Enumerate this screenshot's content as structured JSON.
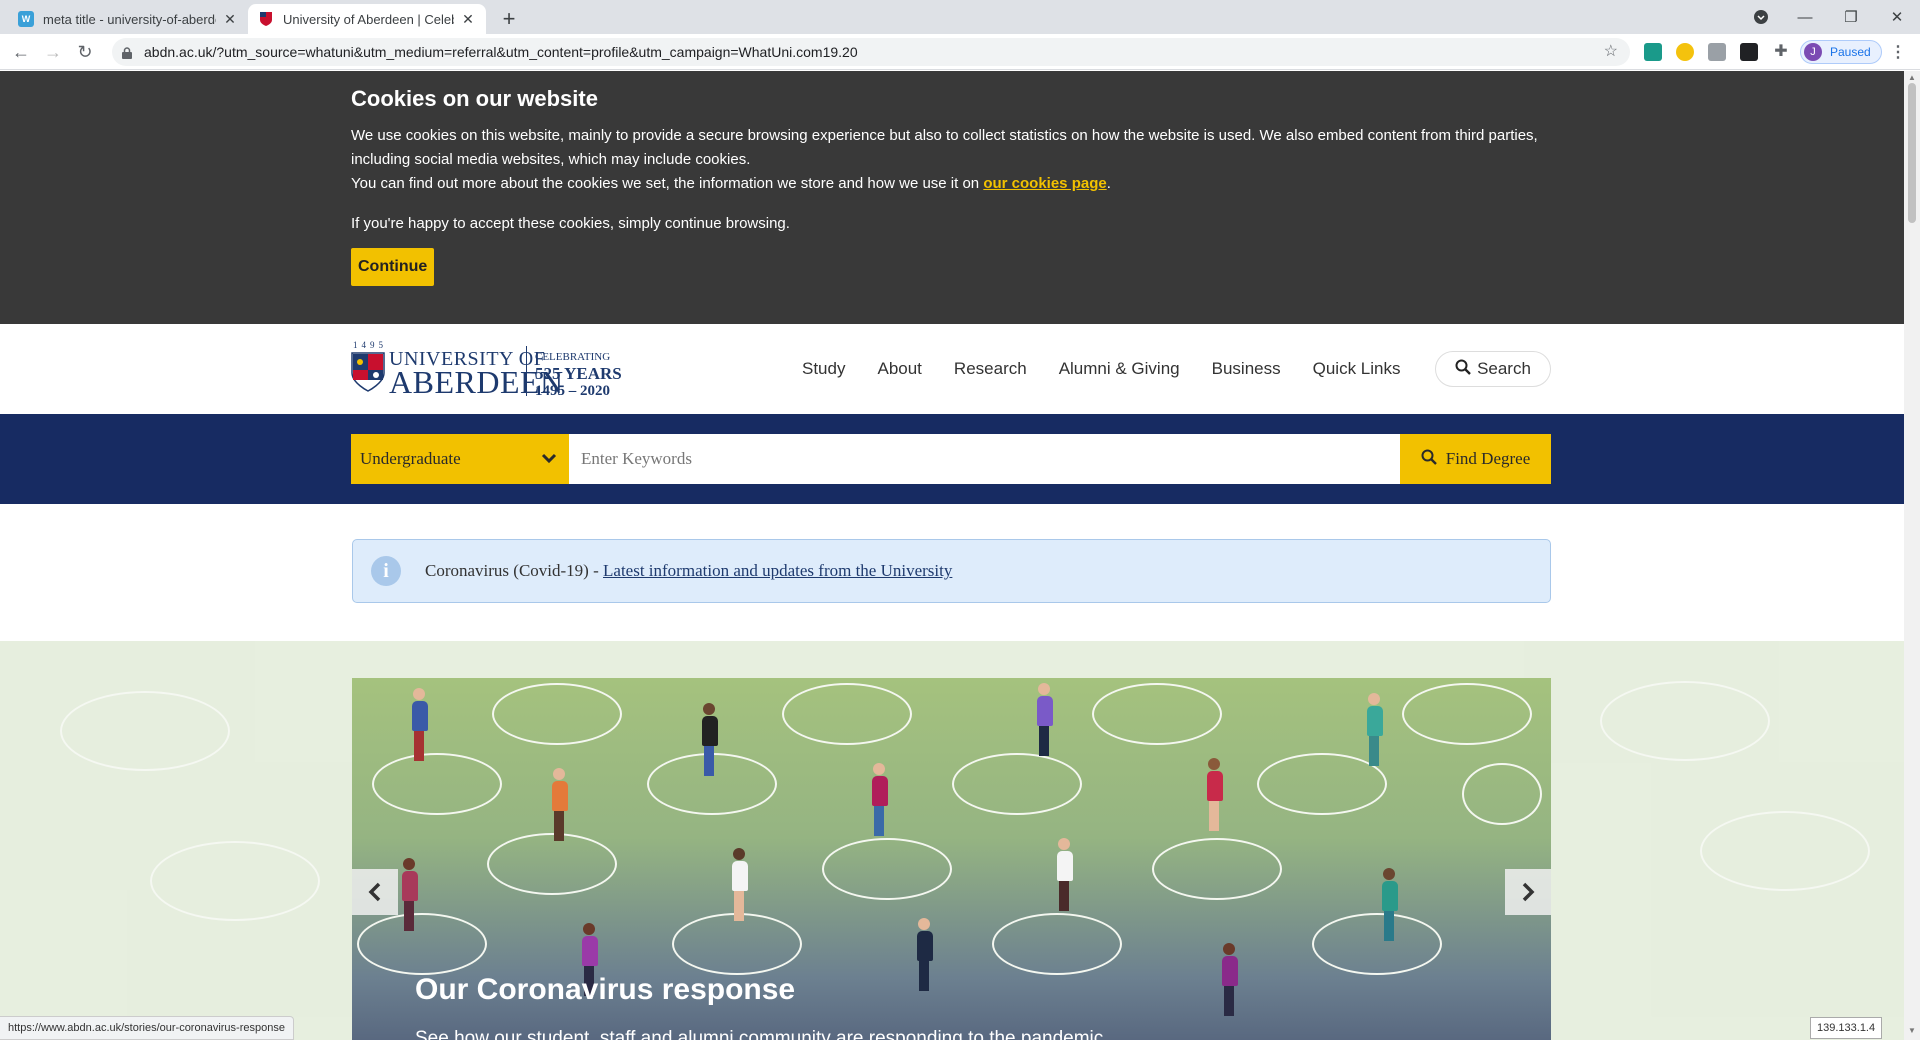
{
  "browser": {
    "tabs": [
      {
        "title": "meta title - university-of-aberdeen",
        "favicon": "whatuni-icon",
        "active": false
      },
      {
        "title": "University of Aberdeen | Celebrating",
        "favicon": "aberdeen-crest-icon",
        "active": true
      }
    ],
    "new_tab": "+",
    "address": "abdn.ac.uk/?utm_source=whatuni&utm_medium=referral&utm_content=profile&utm_campaign=WhatUni.com19.20",
    "profile_initial": "J",
    "profile_status": "Paused",
    "status_url": "https://www.abdn.ac.uk/stories/our-coronavirus-response",
    "ip": "139.133.1.4"
  },
  "cookie": {
    "heading": "Cookies on our website",
    "p1": "We use cookies on this website, mainly to provide a secure browsing experience but also to collect statistics on how the website is used. We also embed content from third parties, including social media websites, which may include cookies.",
    "p2_before": "You can find out more about the cookies we set, the information we store and how we use it on ",
    "p2_link": "our cookies page",
    "p2_after": ".",
    "p3": "If you're happy to accept these cookies, simply continue browsing.",
    "button": "Continue"
  },
  "header": {
    "logo": {
      "year": "1495",
      "line1": "UNIVERSITY OF",
      "line2": "ABERDEEN",
      "celebrating": "CELEBRATING",
      "years": "525 YEARS",
      "range": "1495 – 2020"
    },
    "nav": [
      "Study",
      "About",
      "Research",
      "Alumni & Giving",
      "Business",
      "Quick Links"
    ],
    "search": "Search"
  },
  "finder": {
    "level": "Undergraduate",
    "placeholder": "Enter Keywords",
    "button": "Find Degree"
  },
  "alert": {
    "prefix": "Coronavirus (Covid-19) - ",
    "link": "Latest information and updates from the University"
  },
  "hero": {
    "title": "Our Coronavirus response",
    "subtitle": "See how our student, staff and alumni community are responding to the pandemic"
  },
  "colors": {
    "brand_navy": "#172b62",
    "brand_gold": "#f2c100",
    "cookie_bg": "#393939"
  }
}
